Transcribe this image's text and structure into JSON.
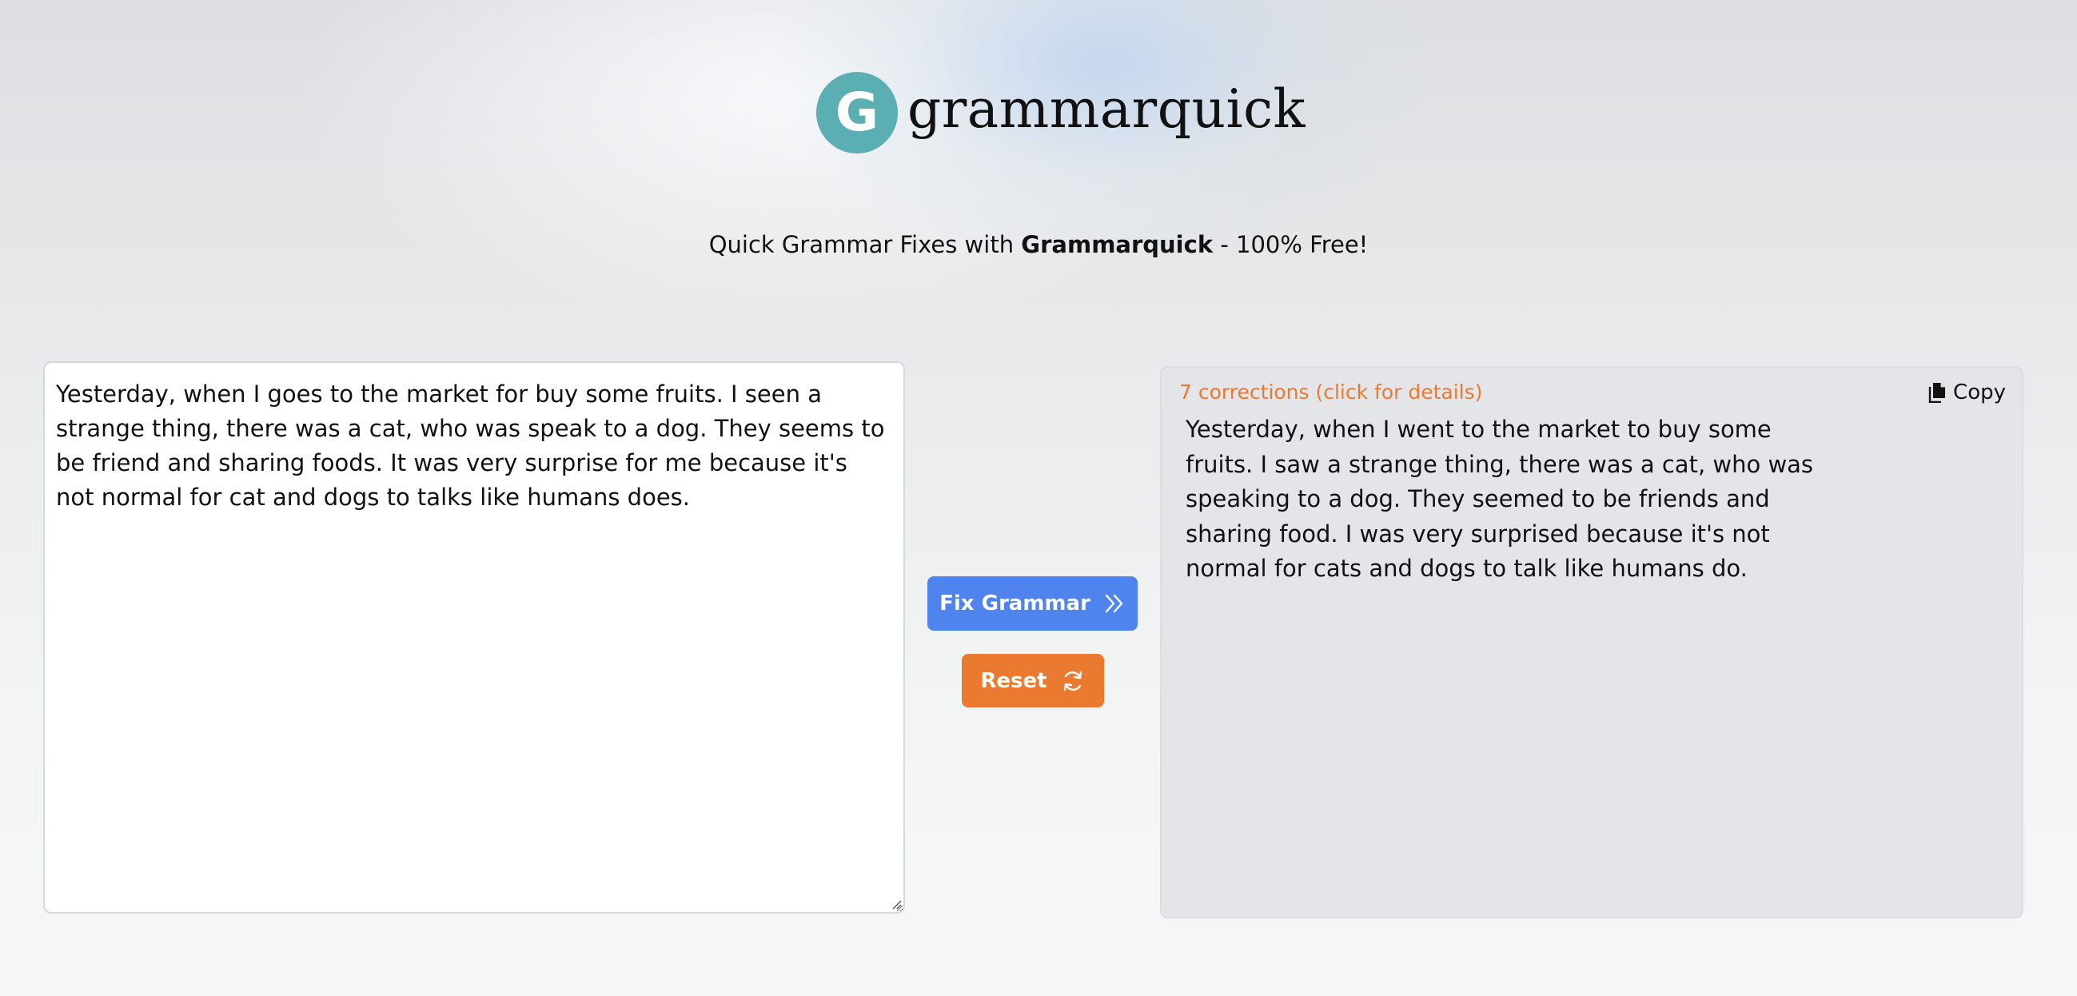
{
  "brand": {
    "logo_letter": "G",
    "name": "grammarquick",
    "accent_color": "#5baeb1"
  },
  "tagline": {
    "prefix": "Quick Grammar Fixes with ",
    "brand": "Grammarquick",
    "suffix": " - 100% Free!"
  },
  "input": {
    "value": "Yesterday, when I goes to the market for buy some fruits. I seen a strange thing, there was a cat, who was speak to a dog. They seems to be friend and sharing foods. It was very surprise for me because it's not normal for cat and dogs to talks like humans does."
  },
  "actions": {
    "fix_label": "Fix Grammar",
    "fix_icon": "double-chevron-right-icon",
    "fix_color": "#4f84ee",
    "reset_label": "Reset",
    "reset_icon": "refresh-icon",
    "reset_color": "#ea7a30"
  },
  "output": {
    "corrections_label": "7 corrections (click for details)",
    "copy_label": "Copy",
    "copy_icon": "copy-icon",
    "text": "Yesterday, when I went to the market to buy some fruits. I saw a strange thing, there was a cat, who was speaking to a dog. They seemed to be friends and sharing food. I was very surprised because it's not normal for cats and dogs to talk like humans do."
  }
}
